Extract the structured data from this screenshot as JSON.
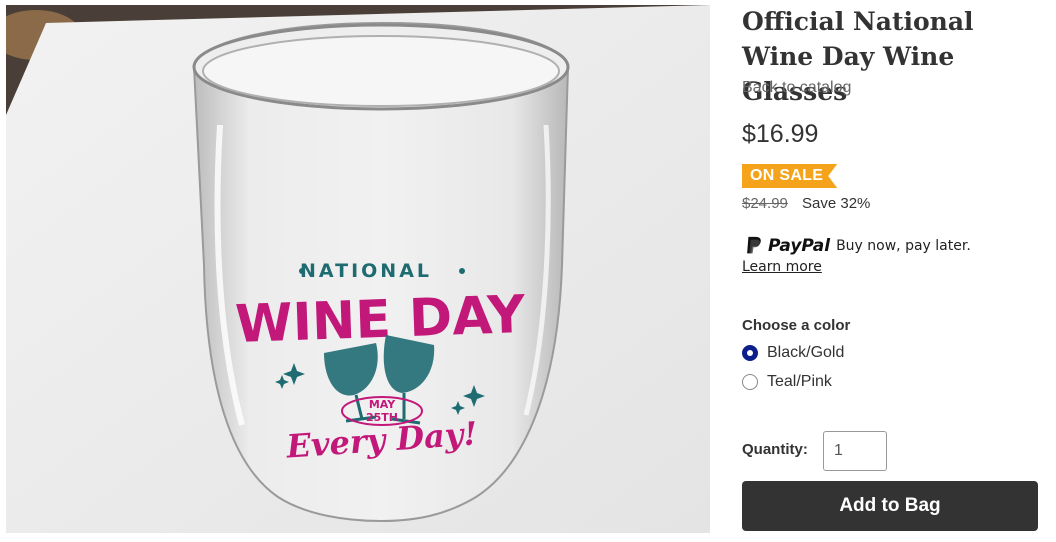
{
  "product": {
    "title": "Official National Wine Day Wine Glasses",
    "back_link": "Back to catalog",
    "price": "$16.99",
    "sale_badge": "ON SALE",
    "original_price": "$24.99",
    "savings": "Save 32%"
  },
  "paypal": {
    "brand": "PayPal",
    "tagline": "Buy now, pay later.",
    "learn_more": "Learn more"
  },
  "color_selector": {
    "label": "Choose a color",
    "options": [
      {
        "label": "Black/Gold",
        "selected": true
      },
      {
        "label": "Teal/Pink",
        "selected": false
      }
    ]
  },
  "quantity": {
    "label": "Quantity:",
    "value": "1"
  },
  "cart": {
    "add_label": "Add to Bag"
  },
  "image": {
    "printed_text": {
      "national": "NATIONAL",
      "wine_day": "WINE DAY",
      "may": "MAY",
      "date": "25TH",
      "tagline": "Every Day!"
    }
  },
  "colors": {
    "sale_badge": "#f5a31a",
    "selected_radio": "#0d1f8c",
    "button_bg": "#333333",
    "print_teal": "#1f6b72",
    "print_pink": "#c2187a"
  }
}
